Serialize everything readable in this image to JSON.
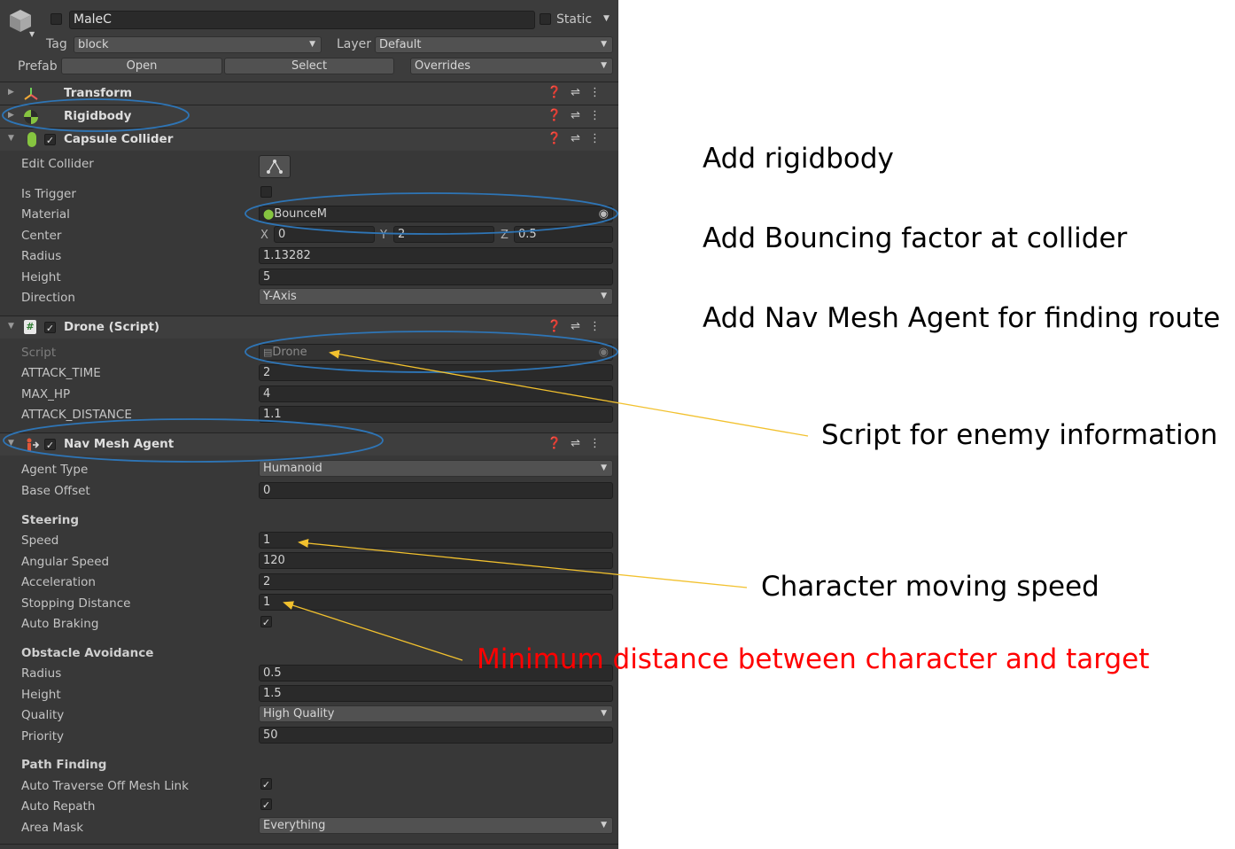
{
  "header": {
    "object_name": "MaleC",
    "static_label": "Static",
    "tag_label": "Tag",
    "tag_value": "block",
    "layer_label": "Layer",
    "layer_value": "Default",
    "prefab_label": "Prefab",
    "open_label": "Open",
    "select_label": "Select",
    "overrides_label": "Overrides"
  },
  "components": {
    "transform": "Transform",
    "rigidbody": "Rigidbody",
    "capsule_collider": "Capsule Collider",
    "drone_script": "Drone (Script)",
    "nav_mesh_agent": "Nav Mesh Agent"
  },
  "collider": {
    "edit_collider_label": "Edit Collider",
    "is_trigger_label": "Is Trigger",
    "material_label": "Material",
    "material_value": "BounceM",
    "center_label": "Center",
    "center_x_label": "X",
    "center_x": "0",
    "center_y_label": "Y",
    "center_y": "2",
    "center_z_label": "Z",
    "center_z": "0.5",
    "radius_label": "Radius",
    "radius_value": "1.13282",
    "height_label": "Height",
    "height_value": "5",
    "direction_label": "Direction",
    "direction_value": "Y-Axis"
  },
  "drone": {
    "script_label": "Script",
    "script_value": "Drone",
    "attack_time_label": "ATTACK_TIME",
    "attack_time": "2",
    "max_hp_label": "MAX_HP",
    "max_hp": "4",
    "attack_distance_label": "ATTACK_DISTANCE",
    "attack_distance": "1.1"
  },
  "agent": {
    "agent_type_label": "Agent Type",
    "agent_type": "Humanoid",
    "base_offset_label": "Base Offset",
    "base_offset": "0",
    "steering_header": "Steering",
    "speed_label": "Speed",
    "speed": "1",
    "angular_speed_label": "Angular Speed",
    "angular_speed": "120",
    "acceleration_label": "Acceleration",
    "acceleration": "2",
    "stopping_distance_label": "Stopping Distance",
    "stopping_distance": "1",
    "auto_braking_label": "Auto Braking",
    "obstacle_header": "Obstacle Avoidance",
    "radius_label": "Radius",
    "radius": "0.5",
    "height_label": "Height",
    "height": "1.5",
    "quality_label": "Quality",
    "quality": "High Quality",
    "priority_label": "Priority",
    "priority": "50",
    "path_header": "Path Finding",
    "auto_traverse_label": "Auto Traverse Off Mesh Link",
    "auto_repath_label": "Auto Repath",
    "area_mask_label": "Area Mask",
    "area_mask": "Everything"
  },
  "annotations": {
    "add_rigidbody": "Add rigidbody",
    "add_bouncing": "Add Bouncing factor at collider",
    "add_navmesh": "Add Nav Mesh Agent for finding route",
    "script_info": "Script for enemy information",
    "moving_speed": "Character moving speed",
    "min_distance": "Minimum distance between character and target",
    "min_distance_color": "#ff0000",
    "arrow_color": "#f2c12e",
    "circle_color": "#2e75b6"
  },
  "colors": {
    "panel_bg": "#383838",
    "field_bg": "#2a2a2a",
    "header_bg": "#3e3e3e"
  }
}
